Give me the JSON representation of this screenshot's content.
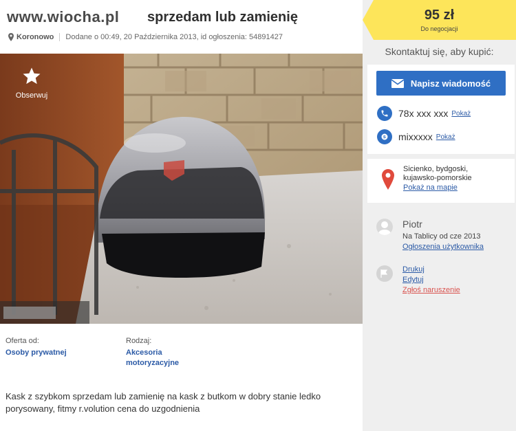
{
  "watermark": "www.wiocha.pl",
  "title": "sprzedam lub zamienię",
  "meta": {
    "location": "Koronowo",
    "added": "Dodane o 00:49, 20 Października 2013, id ogłoszenia: 54891427"
  },
  "observe": {
    "label": "Obserwuj"
  },
  "details": {
    "offer_label": "Oferta od:",
    "offer_value": "Osoby prywatnej",
    "type_label": "Rodzaj:",
    "type_value_line1": "Akcesoria",
    "type_value_line2": "motoryzacyjne"
  },
  "description": "Kask z szybkom sprzedam lub zamienię na kask z butkom w dobry stanie ledko porysowany, fitmy r.volution cena do uzgodnienia",
  "price": {
    "amount": "95 zł",
    "note": "Do negocjacji"
  },
  "contact": {
    "title": "Skontaktuj się, aby kupić:",
    "message_button": "Napisz wiadomość",
    "phone": "78x xxx xxx",
    "phone_show": "Pokaż",
    "skype": "mixxxxx",
    "skype_show": "Pokaż"
  },
  "map": {
    "line1": "Sicienko, bydgoski,",
    "line2": "kujawsko-pomorskie",
    "link": "Pokaż na mapie"
  },
  "user": {
    "name": "Piotr",
    "since": "Na Tablicy od cze 2013",
    "ads_link": "Ogłoszenia użytkownika"
  },
  "actions": {
    "print": "Drukuj",
    "edit": "Edytuj",
    "report": "Zgłoś naruszenie"
  },
  "colors": {
    "accent": "#2f6fc4",
    "price_bg": "#fde55a",
    "report": "#d9534f",
    "sidebar_bg": "#efefef"
  }
}
